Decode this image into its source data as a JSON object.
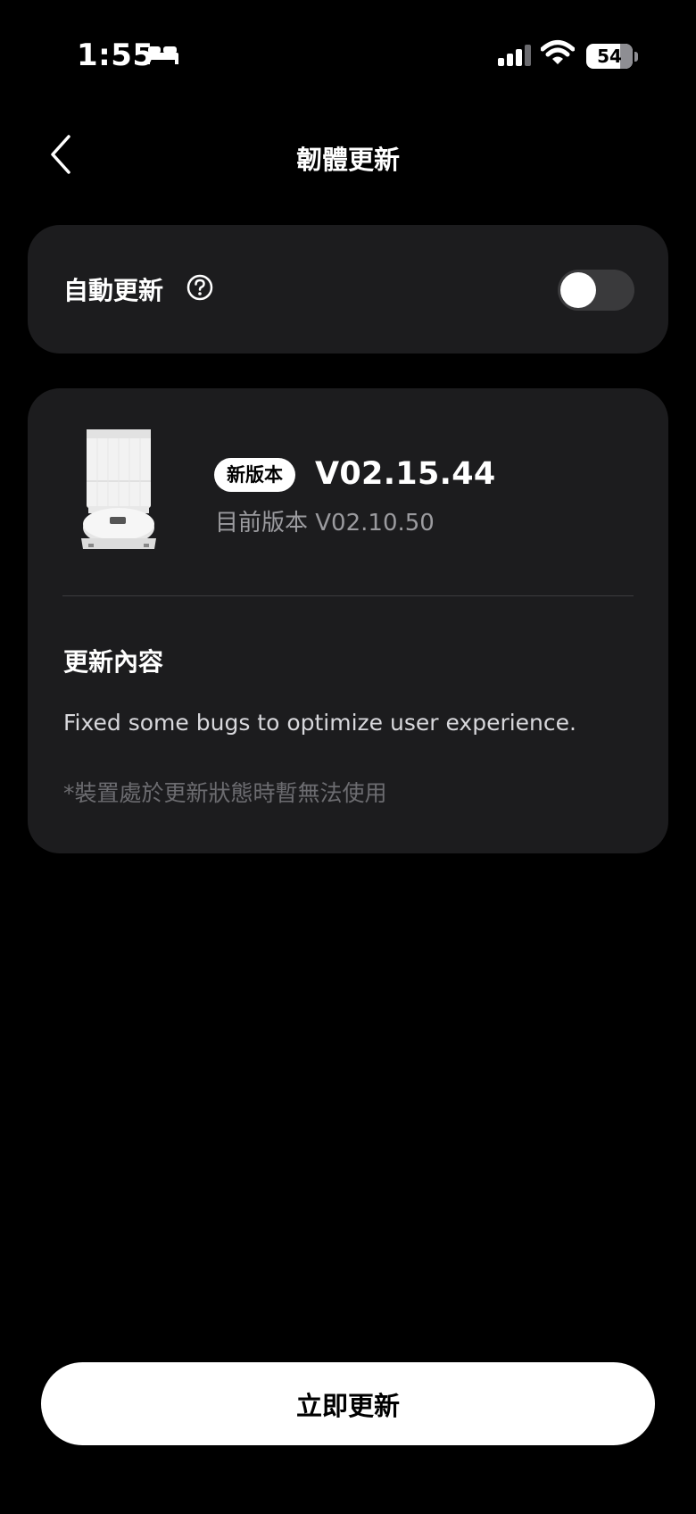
{
  "status_bar": {
    "time": "1:55",
    "sleep_icon": "bed-icon",
    "battery_percent": "54",
    "battery_level": 0.54
  },
  "header": {
    "back_icon": "chevron-left-icon",
    "title": "韌體更新"
  },
  "auto_update": {
    "label": "自動更新",
    "help_icon": "question-circle-icon",
    "enabled": false
  },
  "firmware": {
    "device_image": "robot-vacuum-station-image",
    "new_badge": "新版本",
    "new_version": "V02.15.44",
    "current_version": "目前版本 V02.10.50",
    "content_title": "更新內容",
    "content_body": "Fixed some bugs to optimize user experience.",
    "note": "*裝置處於更新狀態時暫無法使用"
  },
  "actions": {
    "update_now": "立即更新"
  },
  "colors": {
    "background": "#000000",
    "card": "#1c1c1e",
    "secondary_text": "#9b9b9f",
    "muted_text": "#6c6c70",
    "button": "#ffffff"
  }
}
